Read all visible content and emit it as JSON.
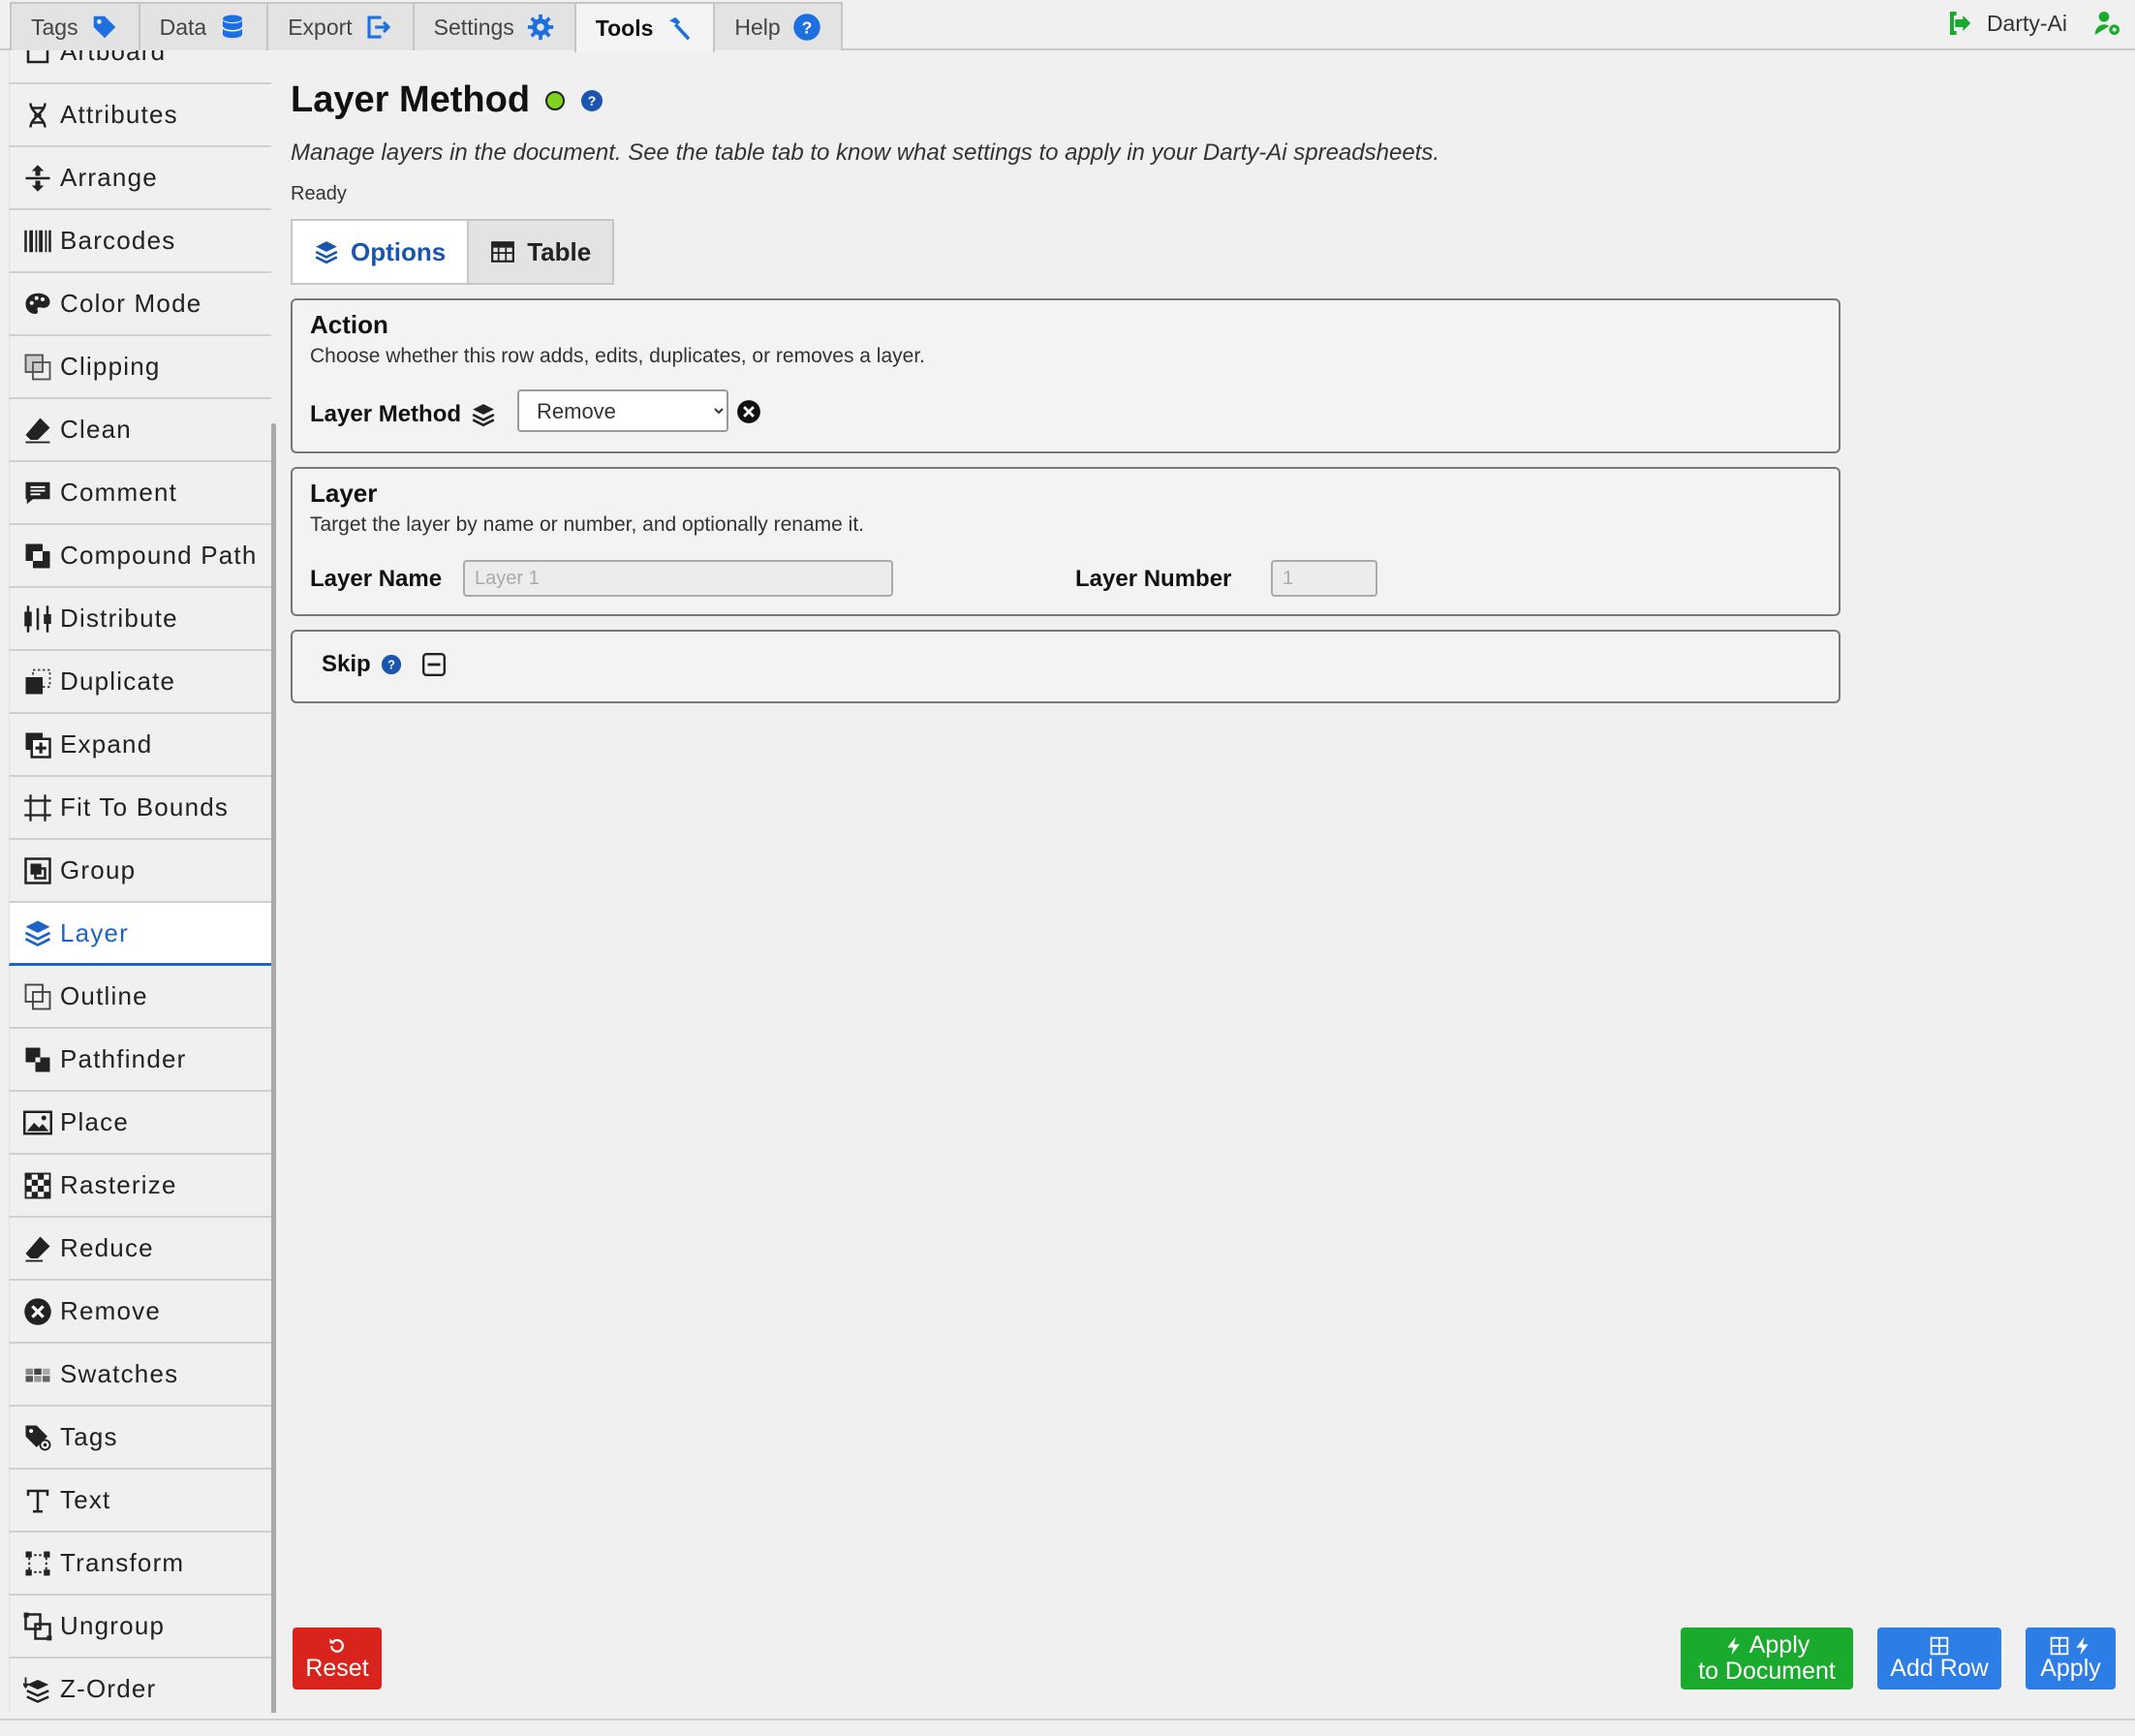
{
  "topbar": {
    "tabs": [
      {
        "label": "Tags",
        "icon": "tag-icon"
      },
      {
        "label": "Data",
        "icon": "database-icon"
      },
      {
        "label": "Export",
        "icon": "export-icon"
      },
      {
        "label": "Settings",
        "icon": "gear-icon"
      },
      {
        "label": "Tools",
        "icon": "hammer-icon"
      },
      {
        "label": "Help",
        "icon": "help-circle-icon"
      }
    ],
    "active_tab": "Tools",
    "user_name": "Darty-Ai"
  },
  "sidebar": {
    "items": [
      {
        "label": "Artboard"
      },
      {
        "label": "Attributes"
      },
      {
        "label": "Arrange"
      },
      {
        "label": "Barcodes"
      },
      {
        "label": "Color Mode"
      },
      {
        "label": "Clipping"
      },
      {
        "label": "Clean"
      },
      {
        "label": "Comment"
      },
      {
        "label": "Compound Path"
      },
      {
        "label": "Distribute"
      },
      {
        "label": "Duplicate"
      },
      {
        "label": "Expand"
      },
      {
        "label": "Fit To Bounds"
      },
      {
        "label": "Group"
      },
      {
        "label": "Layer"
      },
      {
        "label": "Outline"
      },
      {
        "label": "Pathfinder"
      },
      {
        "label": "Place"
      },
      {
        "label": "Rasterize"
      },
      {
        "label": "Reduce"
      },
      {
        "label": "Remove"
      },
      {
        "label": "Swatches"
      },
      {
        "label": "Tags"
      },
      {
        "label": "Text"
      },
      {
        "label": "Transform"
      },
      {
        "label": "Ungroup"
      },
      {
        "label": "Z-Order"
      }
    ],
    "active_item": "Layer"
  },
  "main": {
    "title": "Layer Method",
    "status_color": "#7ed321",
    "description": "Manage layers in the document. See the table tab to know what settings to apply in your Darty-Ai spreadsheets.",
    "status": "Ready",
    "subtabs": [
      {
        "label": "Options"
      },
      {
        "label": "Table"
      }
    ],
    "action_panel": {
      "title": "Action",
      "subtitle": "Choose whether this row adds, edits, duplicates, or removes a layer.",
      "method_label": "Layer Method",
      "method_value": "Remove"
    },
    "layer_panel": {
      "title": "Layer",
      "subtitle": "Target the layer by name or number, and optionally rename it.",
      "name_label": "Layer Name",
      "name_placeholder": "Layer 1",
      "number_label": "Layer Number",
      "number_placeholder": "1"
    },
    "skip_panel": {
      "label": "Skip"
    }
  },
  "footer": {
    "reset_label": "Reset",
    "apply_doc_line1": "Apply",
    "apply_doc_line2": "to Document",
    "add_row_label": "Add Row",
    "apply_label": "Apply"
  },
  "colors": {
    "accent": "#1e63c8",
    "reset": "#d9231d",
    "apply_document": "#1aaa2e",
    "blue_button": "#2c7de6"
  }
}
